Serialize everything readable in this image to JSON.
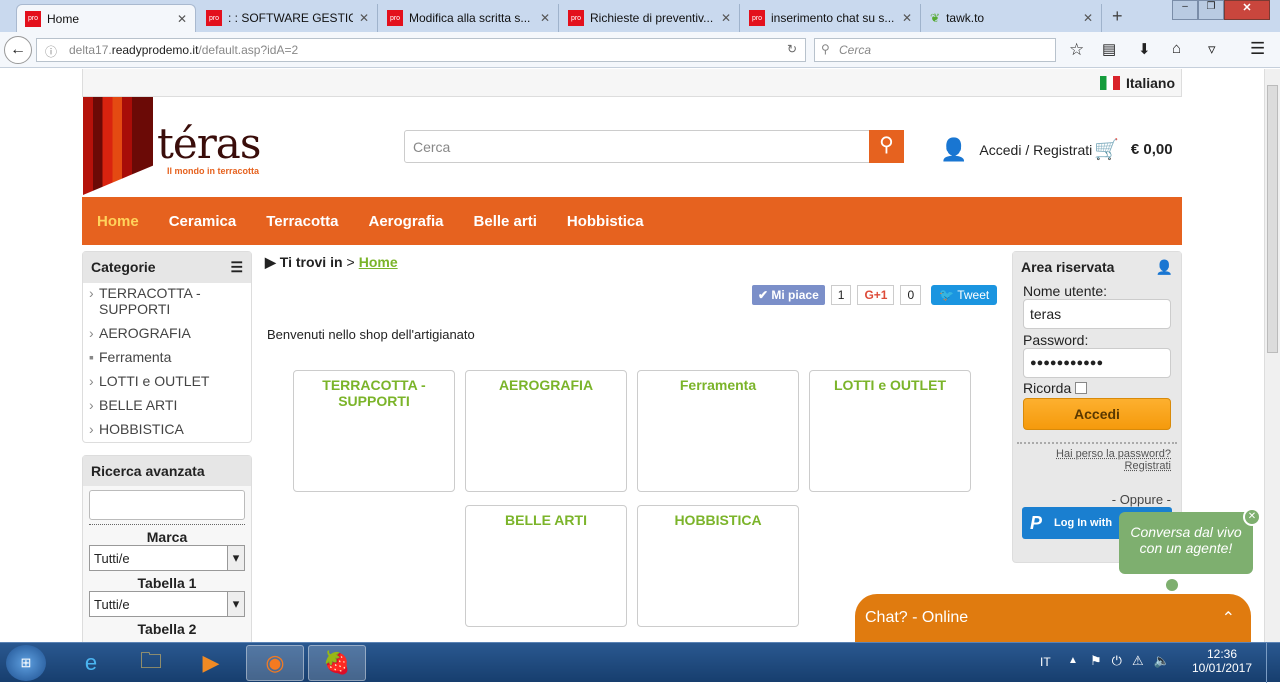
{
  "browser": {
    "tabs": [
      {
        "label": "Home",
        "icon": "pro-favicon"
      },
      {
        "label": ": : SOFTWARE GESTIO...",
        "icon": "pro-favicon"
      },
      {
        "label": "Modifica alla scritta s...",
        "icon": "pro-favicon"
      },
      {
        "label": "Richieste di preventiv...",
        "icon": "pro-favicon"
      },
      {
        "label": "inserimento chat su s...",
        "icon": "pro-favicon"
      },
      {
        "label": "tawk.to",
        "icon": "tawk-favicon"
      }
    ],
    "favicon_text": "pro",
    "url_prefix": "delta17.",
    "url_domain": "readyprodemo.it",
    "url_path": "/default.asp?idA=2",
    "search_placeholder": "Cerca"
  },
  "page": {
    "language": "Italiano",
    "logo": {
      "name": "téras",
      "tagline": "Il mondo in terracotta"
    },
    "search_placeholder": "Cerca",
    "account_label": "Accedi / Registrati",
    "cart_total": "€ 0,00",
    "menu": [
      {
        "label": "Home",
        "active": true
      },
      {
        "label": "Ceramica"
      },
      {
        "label": "Terracotta"
      },
      {
        "label": "Aerografia"
      },
      {
        "label": "Belle arti"
      },
      {
        "label": "Hobbistica"
      }
    ],
    "categories": {
      "title": "Categorie",
      "items": [
        "TERRACOTTA - SUPPORTI",
        "AEROGRAFIA",
        "Ferramenta",
        "LOTTI e OUTLET",
        "BELLE ARTI",
        "HOBBISTICA"
      ]
    },
    "advanced_search": {
      "title": "Ricerca avanzata",
      "brand_label": "Marca",
      "brand_value": "Tutti/e",
      "table1_label": "Tabella 1",
      "table1_value": "Tutti/e",
      "table2_label": "Tabella 2"
    },
    "breadcrumb": {
      "prefix": "Ti trovi in",
      "sep": ">",
      "current": "Home"
    },
    "social": {
      "like": "Mi piace",
      "like_count": "1",
      "gplus": "G+1",
      "gplus_count": "0",
      "tweet": "Tweet"
    },
    "welcome": "Benvenuti nello shop dell'artigianato",
    "cards": [
      "TERRACOTTA - SUPPORTI",
      "AEROGRAFIA",
      "Ferramenta",
      "LOTTI e OUTLET",
      "BELLE ARTI",
      "HOBBISTICA"
    ],
    "login": {
      "title": "Area riservata",
      "user_label": "Nome utente:",
      "user_value": "teras",
      "pass_label": "Password:",
      "pass_value": "●●●●●●●●●●●",
      "remember": "Ricorda",
      "submit": "Accedi",
      "lost": "Hai perso la password?",
      "register": "Registrati",
      "or": "- Oppure -",
      "paypal": "Log In with"
    },
    "chat": {
      "bubble": "Conversa dal vivo con un agente!",
      "bar": "Chat? - Online"
    }
  },
  "taskbar": {
    "lang": "IT",
    "time": "12:36",
    "date": "10/01/2017"
  },
  "colors": {
    "brand": "#e6621f",
    "green": "#7bb42a",
    "chat": "#e07b0f"
  }
}
